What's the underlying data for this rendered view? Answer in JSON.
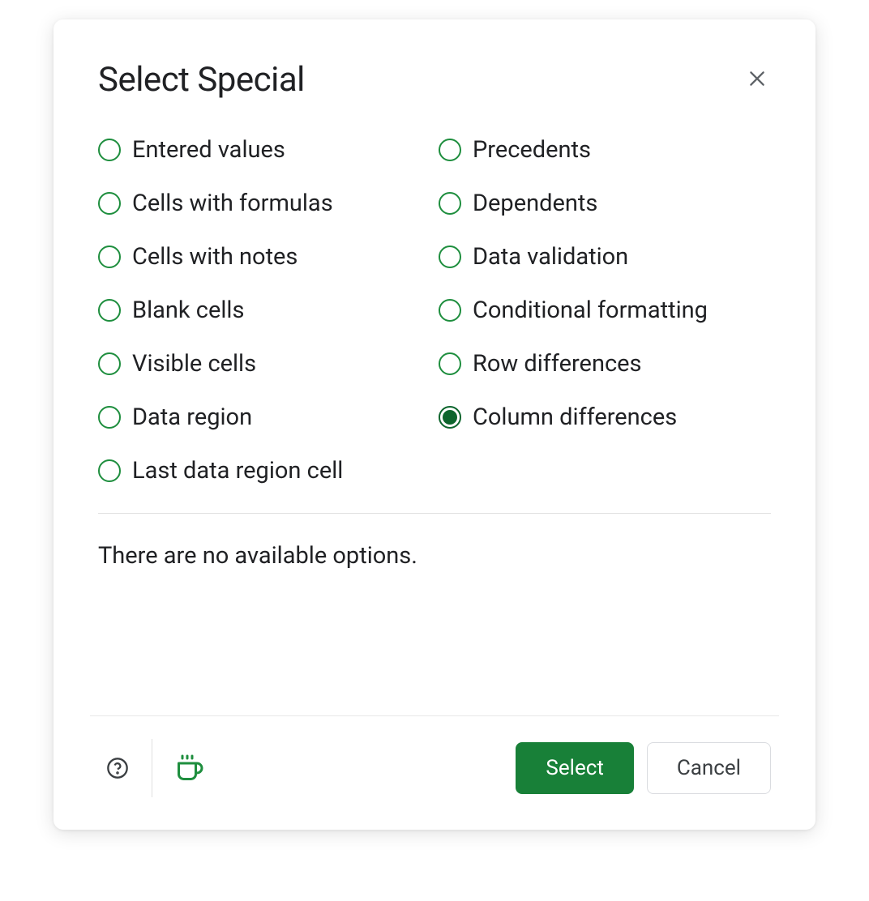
{
  "dialog": {
    "title": "Select Special",
    "info_text": "There are no available options.",
    "selected": "column-differences",
    "options_left": [
      {
        "id": "entered-values",
        "label": "Entered values"
      },
      {
        "id": "cells-with-formulas",
        "label": "Cells with formulas"
      },
      {
        "id": "cells-with-notes",
        "label": "Cells with notes"
      },
      {
        "id": "blank-cells",
        "label": "Blank cells"
      },
      {
        "id": "visible-cells",
        "label": "Visible cells"
      },
      {
        "id": "data-region",
        "label": "Data region"
      },
      {
        "id": "last-data-region-cell",
        "label": "Last data region cell"
      }
    ],
    "options_right": [
      {
        "id": "precedents",
        "label": "Precedents"
      },
      {
        "id": "dependents",
        "label": "Dependents"
      },
      {
        "id": "data-validation",
        "label": "Data validation"
      },
      {
        "id": "conditional-formatting",
        "label": "Conditional formatting"
      },
      {
        "id": "row-differences",
        "label": "Row differences"
      },
      {
        "id": "column-differences",
        "label": "Column differences"
      }
    ],
    "buttons": {
      "select": "Select",
      "cancel": "Cancel"
    }
  }
}
